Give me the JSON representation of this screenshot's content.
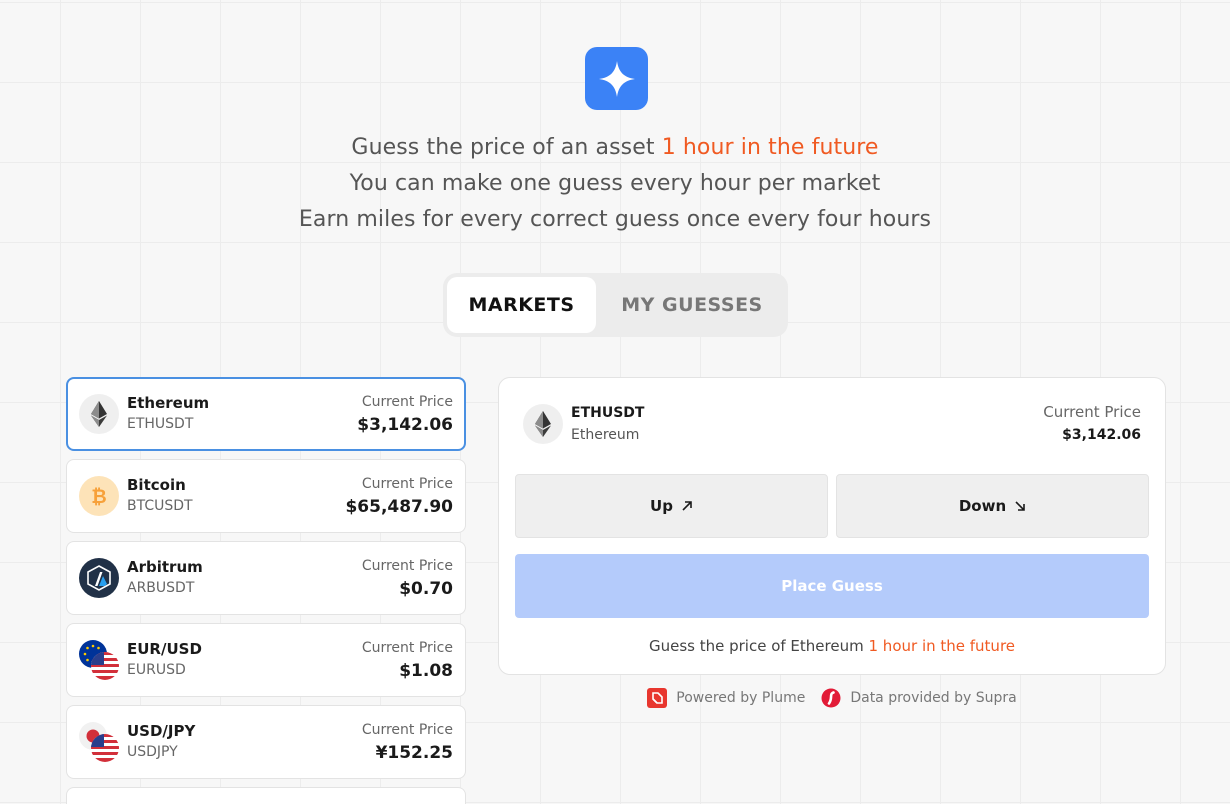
{
  "intro": {
    "line1_prefix": "Guess the price of an asset",
    "line1_accent": "1 hour in the future",
    "line2": "You can make one guess every hour per market",
    "line3": "Earn miles for every correct guess once every four hours"
  },
  "tabs": [
    {
      "label": "MARKETS",
      "active": true
    },
    {
      "label": "MY GUESSES",
      "active": false
    }
  ],
  "markets": [
    {
      "name": "Ethereum",
      "pair": "ETHUSDT",
      "price_label": "Current Price",
      "price": "$3,142.06",
      "icon": "ethereum-icon",
      "selected": true
    },
    {
      "name": "Bitcoin",
      "pair": "BTCUSDT",
      "price_label": "Current Price",
      "price": "$65,487.90",
      "icon": "bitcoin-icon"
    },
    {
      "name": "Arbitrum",
      "pair": "ARBUSDT",
      "price_label": "Current Price",
      "price": "$0.70",
      "icon": "arbitrum-icon"
    },
    {
      "name": "EUR/USD",
      "pair": "EURUSD",
      "price_label": "Current Price",
      "price": "$1.08",
      "icon": "eu-us-flags-icon"
    },
    {
      "name": "USD/JPY",
      "pair": "USDJPY",
      "price_label": "Current Price",
      "price": "¥152.25",
      "icon": "jp-us-flags-icon"
    }
  ],
  "panel": {
    "symbol": "ETHUSDT",
    "name": "Ethereum",
    "price_label": "Current Price",
    "price": "$3,142.06",
    "up_label": "Up",
    "down_label": "Down",
    "place_label": "Place Guess",
    "note_prefix": "Guess the price of Ethereum",
    "note_accent": "1 hour in the future"
  },
  "footer": {
    "powered": "Powered by Plume",
    "data": "Data provided by Supra"
  },
  "colors": {
    "accent": "#f05a22",
    "brand_blue": "#3b82f6",
    "place_button": "#b4cbfb",
    "selected_border": "#4a90e2"
  }
}
